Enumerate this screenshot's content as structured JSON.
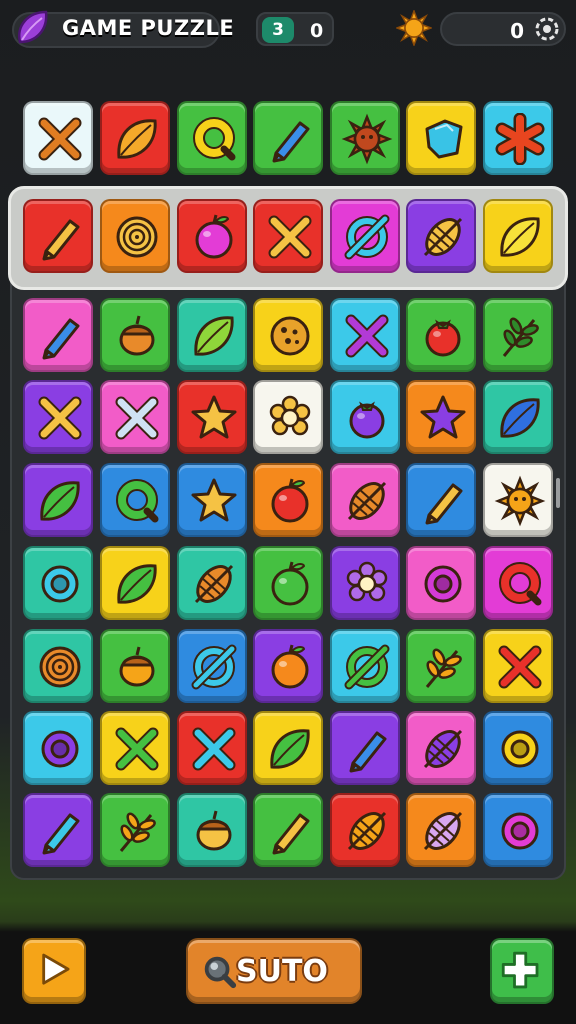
{
  "header": {
    "title": "GAME PUZZLE",
    "moves_badge": "3",
    "moves_value": "0",
    "score_value": "0"
  },
  "colors": {
    "red": "#e8312a",
    "orange": "#f5891c",
    "yellow": "#f7d21a",
    "green": "#45c041",
    "teal": "#2fc6a4",
    "cyan": "#3cc9e9",
    "blue": "#2f8be0",
    "purple": "#8a3ee3",
    "magenta": "#e33cd6",
    "pink": "#f25cc8",
    "white": "#f7f6ee",
    "pale": "#eaf8fa"
  },
  "board": {
    "columns": 7,
    "rows": 9,
    "highlighted_row": 1,
    "tiles": [
      [
        [
          "pale",
          "cross-icon",
          "#e07d22"
        ],
        [
          "red",
          "leaf-icon",
          "#f4a92a"
        ],
        [
          "green",
          "ring-icon",
          "#f7d21a"
        ],
        [
          "green",
          "pencil-icon",
          "#3a8ee8"
        ],
        [
          "green",
          "sun-icon",
          "#c0481e"
        ],
        [
          "yellow",
          "gem-icon",
          "#39c3e6"
        ],
        [
          "cyan",
          "asterisk-icon",
          "#e8451f"
        ]
      ],
      [
        [
          "red",
          "pencil-icon",
          "#f5c244"
        ],
        [
          "orange",
          "spiral-icon",
          "#f5c244"
        ],
        [
          "red",
          "apple-icon",
          "#e33cd6"
        ],
        [
          "red",
          "cross-icon",
          "#f5c244"
        ],
        [
          "magenta",
          "slash-circle-icon",
          "#3cc9e9"
        ],
        [
          "purple",
          "striped-leaf-icon",
          "#f5c244"
        ],
        [
          "yellow",
          "leaf-icon",
          "#f7e13a"
        ]
      ],
      [
        [
          "pink",
          "pencil-icon",
          "#3a8ee8"
        ],
        [
          "green",
          "acorn-icon",
          "#e88a2a"
        ],
        [
          "teal",
          "leaf-icon",
          "#8fd63a"
        ],
        [
          "yellow",
          "cookie-icon",
          "#e8a22a"
        ],
        [
          "cyan",
          "cross-icon",
          "#b23ad6"
        ],
        [
          "green",
          "berry-icon",
          "#e8312a"
        ],
        [
          "green",
          "fern-icon",
          "#2e8a2a"
        ]
      ],
      [
        [
          "purple",
          "cross-icon",
          "#f5c244"
        ],
        [
          "pink",
          "cross-icon",
          "#cfe2f3"
        ],
        [
          "red",
          "star-icon",
          "#f5c244"
        ],
        [
          "white",
          "flower-icon",
          "#f5c244"
        ],
        [
          "cyan",
          "berry-icon",
          "#8a3ee3"
        ],
        [
          "orange",
          "star-icon",
          "#8a3ee3"
        ],
        [
          "teal",
          "leaf-icon",
          "#2f6fe0"
        ]
      ],
      [
        [
          "purple",
          "leaf-icon",
          "#45c041"
        ],
        [
          "blue",
          "ring-icon",
          "#45c041"
        ],
        [
          "blue",
          "star-icon",
          "#f5c244"
        ],
        [
          "orange",
          "apple-icon",
          "#e8312a"
        ],
        [
          "pink",
          "striped-leaf-icon",
          "#e88a2a"
        ],
        [
          "blue",
          "pencil-icon",
          "#f5c244"
        ],
        [
          "white",
          "sun-icon",
          "#f5a418"
        ]
      ],
      [
        [
          "teal",
          "donut-icon",
          "#3cc9e9"
        ],
        [
          "yellow",
          "leaf-icon",
          "#45c041"
        ],
        [
          "teal",
          "striped-leaf-icon",
          "#e88a2a"
        ],
        [
          "green",
          "apple-icon",
          "#45c041"
        ],
        [
          "purple",
          "flower-icon",
          "#b06ae8"
        ],
        [
          "pink",
          "donut-icon",
          "#d43ad6"
        ],
        [
          "magenta",
          "ring-icon",
          "#e8312a"
        ]
      ],
      [
        [
          "teal",
          "spiral-icon",
          "#e88a2a"
        ],
        [
          "green",
          "acorn-icon",
          "#f5a418"
        ],
        [
          "blue",
          "slash-circle-icon",
          "#3cc9e9"
        ],
        [
          "purple",
          "apple-icon",
          "#f5891c"
        ],
        [
          "cyan",
          "slash-circle-icon",
          "#45c041"
        ],
        [
          "green",
          "fern-icon",
          "#f5a418"
        ],
        [
          "yellow",
          "cross-icon",
          "#e8312a"
        ]
      ],
      [
        [
          "cyan",
          "donut-icon",
          "#8a3ee3"
        ],
        [
          "yellow",
          "cross-icon",
          "#45c041"
        ],
        [
          "red",
          "cross-icon",
          "#3cc9e9"
        ],
        [
          "yellow",
          "leaf-icon",
          "#45c041"
        ],
        [
          "purple",
          "pencil-icon",
          "#3a8ee8"
        ],
        [
          "pink",
          "striped-leaf-icon",
          "#8a3ee3"
        ],
        [
          "blue",
          "donut-icon",
          "#f7d21a"
        ]
      ],
      [
        [
          "purple",
          "pencil-icon",
          "#3cc9e9"
        ],
        [
          "green",
          "fern-icon",
          "#f5a418"
        ],
        [
          "teal",
          "acorn-icon",
          "#f5c244"
        ],
        [
          "green",
          "pencil-icon",
          "#f5c244"
        ],
        [
          "red",
          "striped-leaf-icon",
          "#f5a418"
        ],
        [
          "orange",
          "striped-leaf-icon",
          "#d8a6f0"
        ],
        [
          "blue",
          "donut-icon",
          "#e33cd6"
        ]
      ]
    ]
  },
  "footer": {
    "auto_label": "SUTO"
  }
}
